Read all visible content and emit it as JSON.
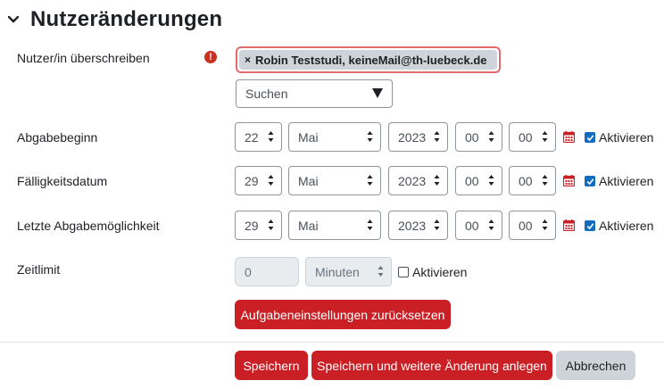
{
  "section": {
    "title": "Nutzeränderungen"
  },
  "override": {
    "label": "Nutzer/in überschreiben",
    "required_icon": "exclamation-circle-icon",
    "selected_user": "Robin Teststudi, keineMail@th-luebeck.de",
    "remove_symbol": "×",
    "search_placeholder": "Suchen"
  },
  "dates": [
    {
      "label": "Abgabebeginn",
      "day": "22",
      "month": "Mai",
      "year": "2023",
      "hour": "00",
      "minute": "00",
      "enable_label": "Aktivieren",
      "enabled": true
    },
    {
      "label": "Fälligkeitsdatum",
      "day": "29",
      "month": "Mai",
      "year": "2023",
      "hour": "00",
      "minute": "00",
      "enable_label": "Aktivieren",
      "enabled": true
    },
    {
      "label": "Letzte Abgabemöglichkeit",
      "day": "29",
      "month": "Mai",
      "year": "2023",
      "hour": "00",
      "minute": "00",
      "enable_label": "Aktivieren",
      "enabled": true
    }
  ],
  "timelimit": {
    "label": "Zeitlimit",
    "value": "0",
    "unit": "Minuten",
    "enable_label": "Aktivieren",
    "enabled": false
  },
  "buttons": {
    "reset": "Aufgabeneinstellungen zurücksetzen",
    "save": "Speichern",
    "save_and_add": "Speichern und weitere Änderung anlegen",
    "cancel": "Abbrechen"
  },
  "colors": {
    "primary_button": "#c91f25",
    "secondary_button": "#ced4da",
    "checkbox_checked": "#0f6cbf",
    "required_icon": "#ca3120",
    "calendar_icon": "#c91f25"
  }
}
